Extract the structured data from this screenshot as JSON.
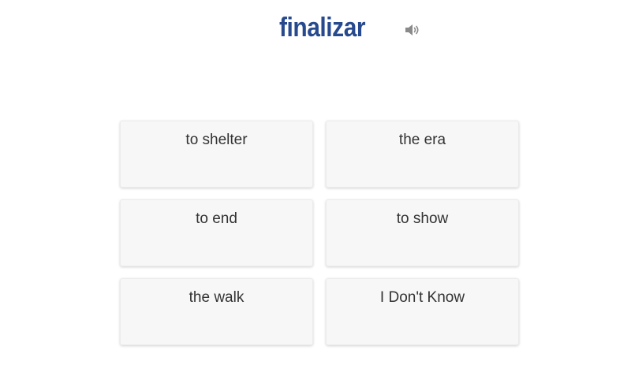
{
  "prompt": {
    "word": "finalizar",
    "audio_icon": "speaker-icon"
  },
  "choices": [
    {
      "label": "to shelter"
    },
    {
      "label": "the era"
    },
    {
      "label": "to end"
    },
    {
      "label": "to show"
    },
    {
      "label": "the walk"
    },
    {
      "label": "I Don't Know"
    }
  ],
  "colors": {
    "word": "#274a8f",
    "card_background": "#f7f7f7",
    "card_text": "#333333",
    "speaker_icon": "#8a8a8a"
  }
}
